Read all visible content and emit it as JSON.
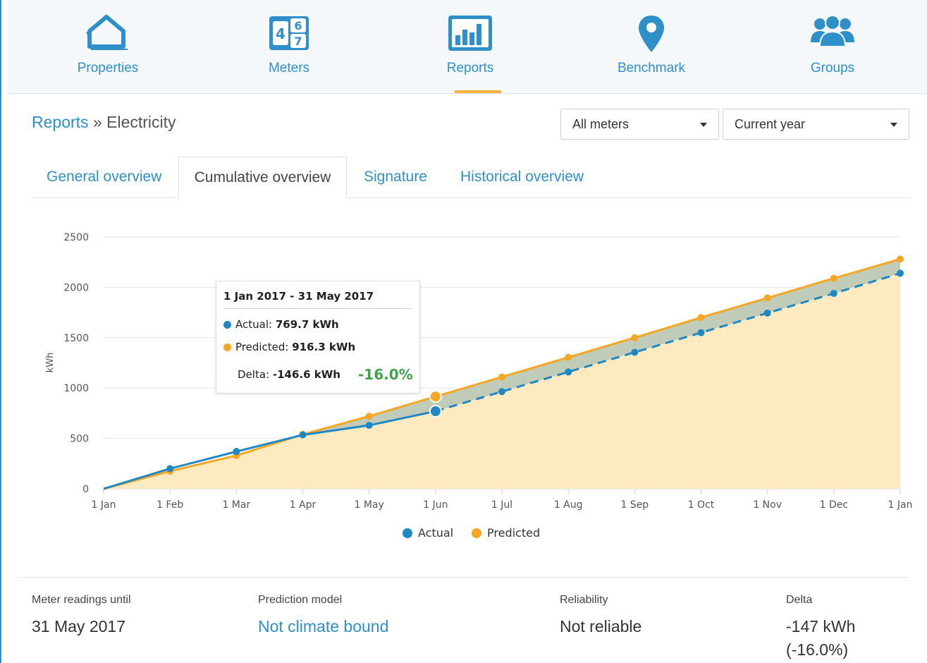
{
  "nav": {
    "items": [
      {
        "label": "Properties",
        "icon": "house-icon"
      },
      {
        "label": "Meters",
        "icon": "meter-digits-icon"
      },
      {
        "label": "Reports",
        "icon": "bar-chart-icon"
      },
      {
        "label": "Benchmark",
        "icon": "map-pin-icon"
      },
      {
        "label": "Groups",
        "icon": "users-group-icon"
      }
    ],
    "active": "Reports"
  },
  "breadcrumb": {
    "root": "Reports",
    "separator": "»",
    "current": "Electricity"
  },
  "filters": {
    "meters": "All meters",
    "period": "Current year"
  },
  "tabs": [
    {
      "label": "General overview"
    },
    {
      "label": "Cumulative overview"
    },
    {
      "label": "Signature"
    },
    {
      "label": "Historical overview"
    }
  ],
  "active_tab": "Cumulative overview",
  "tooltip": {
    "range": "1 Jan 2017 - 31 May 2017",
    "actual_label": "Actual:",
    "actual_value": "769.7 kWh",
    "predicted_label": "Predicted:",
    "predicted_value": "916.3 kWh",
    "delta_label": "Delta:",
    "delta_value": "-146.6 kWh",
    "delta_pct": "-16.0%"
  },
  "chart_data": {
    "type": "line",
    "ylabel": "kWh",
    "ylim": [
      0,
      2500
    ],
    "yticks": [
      0,
      500,
      1000,
      1500,
      2000,
      2500
    ],
    "x": [
      "1 Jan",
      "1 Feb",
      "1 Mar",
      "1 Apr",
      "1 May",
      "1 Jun",
      "1 Jul",
      "1 Aug",
      "1 Sep",
      "1 Oct",
      "1 Nov",
      "1 Dec",
      "1 Jan"
    ],
    "series": [
      {
        "name": "Actual",
        "color": "#1f88c4",
        "values": [
          0,
          200,
          370,
          535,
          630,
          770,
          965,
          1160,
          1355,
          1550,
          1745,
          1940,
          2140
        ],
        "measured_until_index": 5,
        "projection_style": "dashed"
      },
      {
        "name": "Predicted",
        "color": "#f5a623",
        "values": [
          0,
          175,
          330,
          540,
          720,
          916,
          1110,
          1305,
          1500,
          1700,
          1895,
          2090,
          2280
        ]
      }
    ],
    "area_fill": "#fdeac0",
    "delta_fill": "#b9c9b6",
    "grid": true,
    "legend_position": "bottom-center",
    "highlight_index": 5
  },
  "stats": [
    {
      "label": "Meter readings until",
      "value": "31 May 2017"
    },
    {
      "label": "Prediction model",
      "value": "Not climate bound"
    },
    {
      "label": "Reliability",
      "value": "Not reliable"
    },
    {
      "label": "Delta",
      "value": "-147 kWh",
      "value2": "(-16.0%)"
    }
  ]
}
